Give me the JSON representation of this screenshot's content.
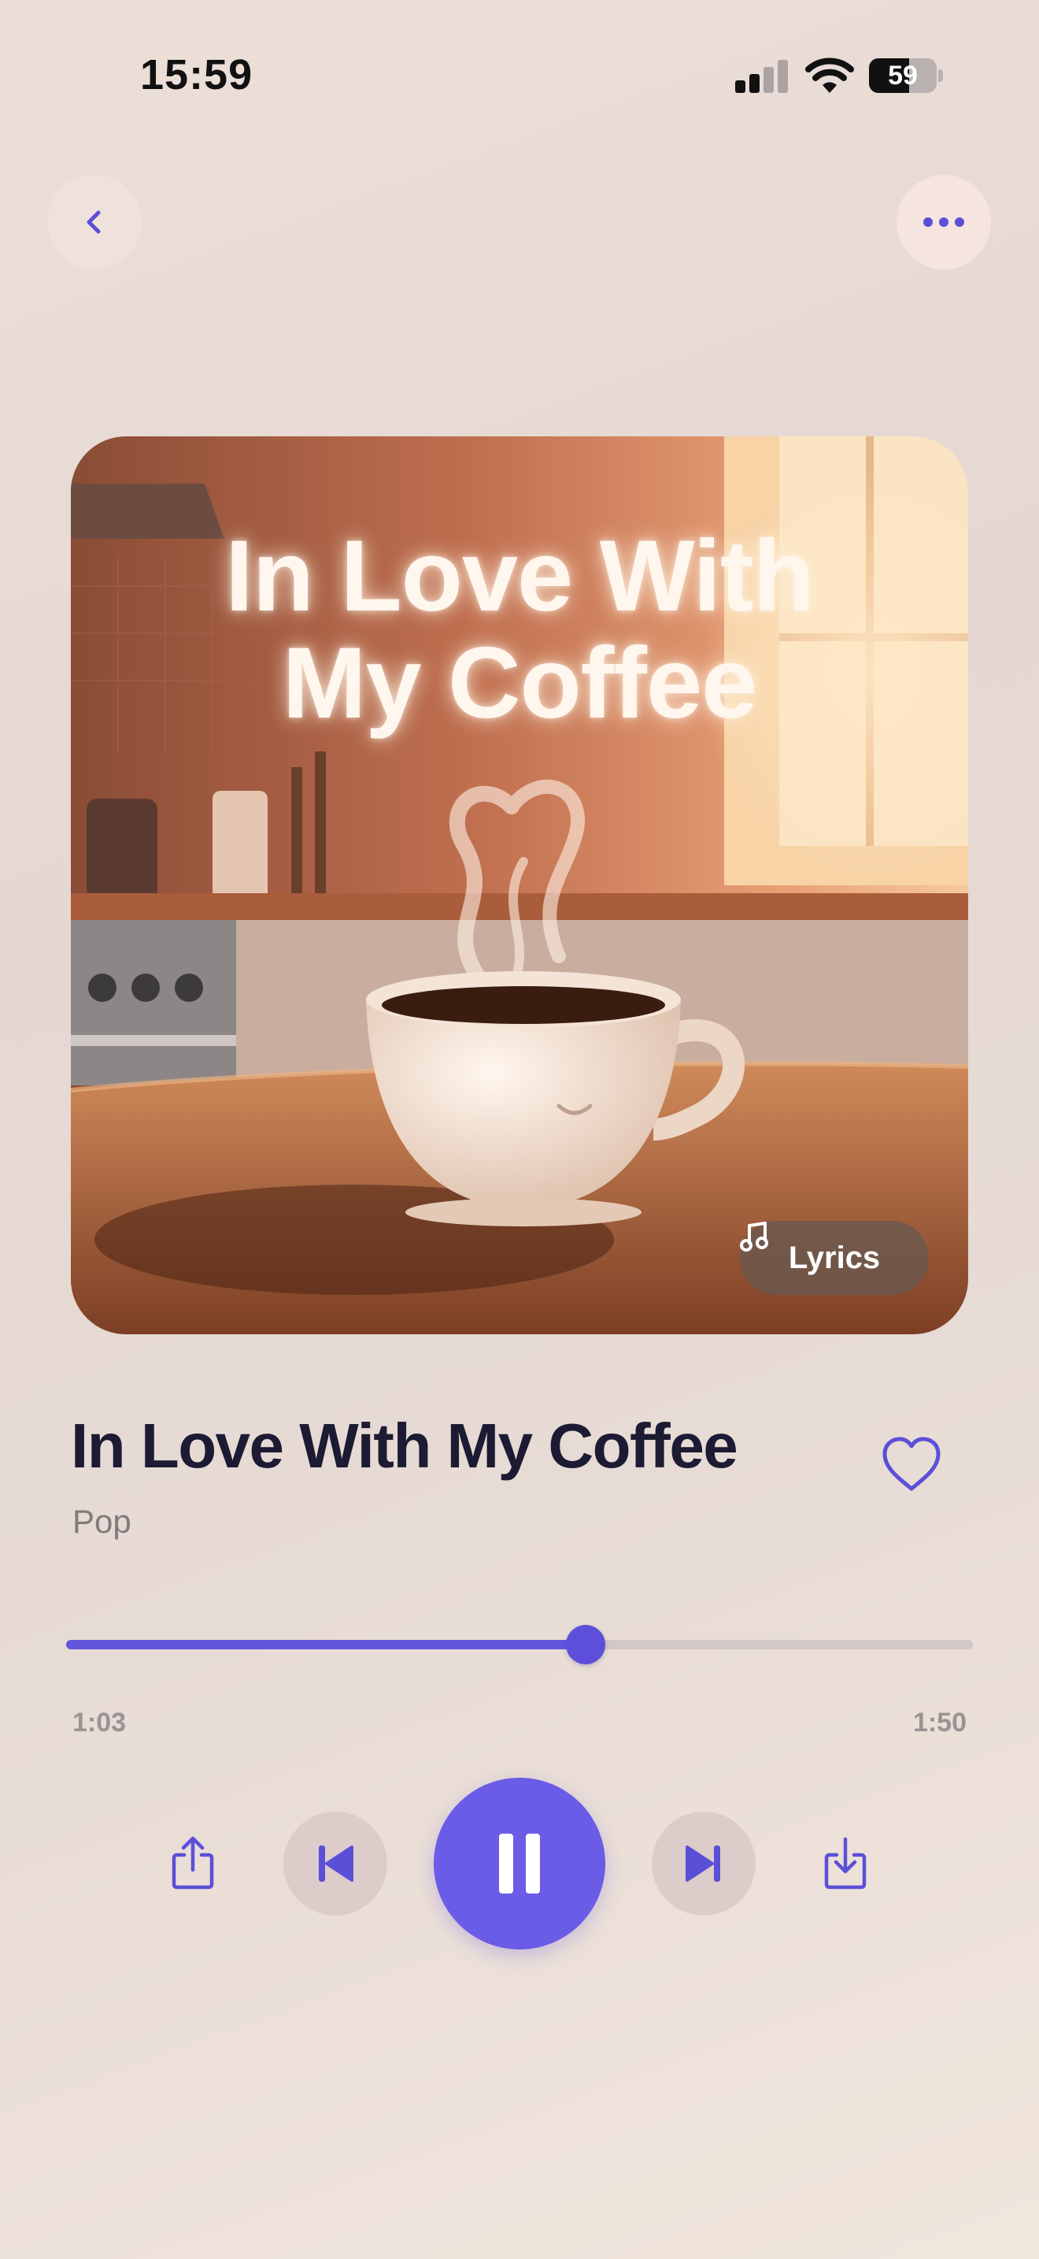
{
  "status_bar": {
    "time": "15:59",
    "battery": "59",
    "battery_level": 0.59
  },
  "nav": {
    "back_icon": "chevron-left-icon",
    "more_icon": "ellipsis-icon"
  },
  "artwork": {
    "title": "In Love With\nMy Coffee",
    "lyrics_label": "Lyrics",
    "lyrics_icon": "music-note-icon"
  },
  "song": {
    "title": "In Love With My Coffee",
    "genre": "Pop",
    "favorite_icon": "heart-icon"
  },
  "progress": {
    "elapsed": "1:03",
    "total": "1:50",
    "fraction": 0.573
  },
  "controls": {
    "share_icon": "share-icon",
    "previous_icon": "skip-back-icon",
    "play_pause_icon": "pause-icon",
    "next_icon": "skip-forward-icon",
    "download_icon": "download-icon"
  },
  "colors": {
    "accent": "#6a5ce6",
    "title": "#1c1b33",
    "muted": "#807a7b"
  }
}
